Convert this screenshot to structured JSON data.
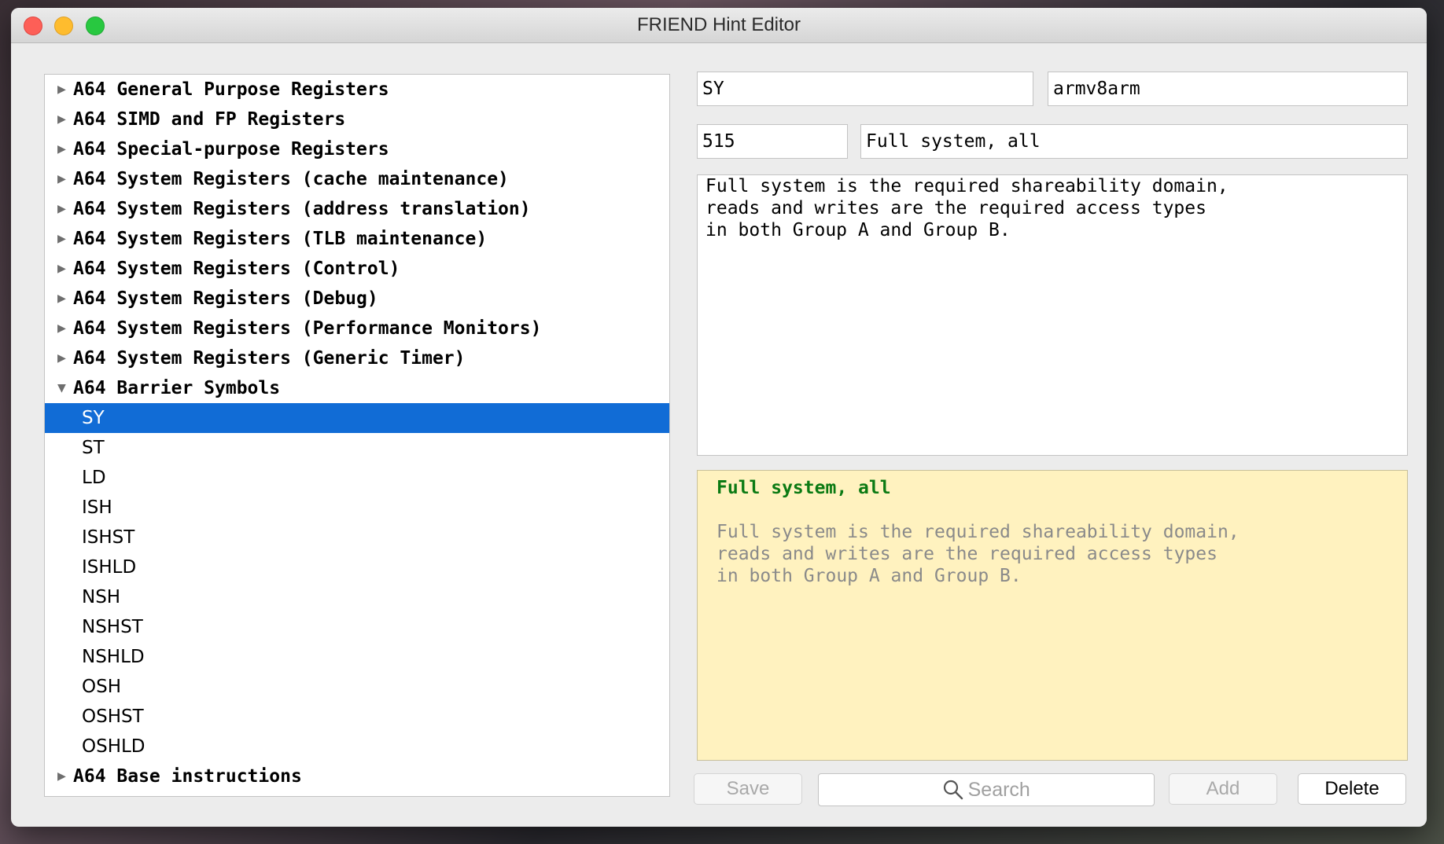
{
  "window": {
    "title": "FRIEND Hint Editor"
  },
  "tree": {
    "groups_before": [
      "A64 General Purpose Registers",
      "A64 SIMD and FP Registers",
      "A64 Special-purpose Registers",
      "A64 System Registers (cache maintenance)",
      "A64 System Registers (address translation)",
      "A64 System Registers (TLB maintenance)",
      "A64 System Registers (Control)",
      "A64 System Registers (Debug)",
      "A64 System Registers (Performance Monitors)",
      "A64 System Registers (Generic Timer)"
    ],
    "expanded_group": "A64 Barrier Symbols",
    "children": [
      "SY",
      "ST",
      "LD",
      "ISH",
      "ISHST",
      "ISHLD",
      "NSH",
      "NSHST",
      "NSHLD",
      "OSH",
      "OSHST",
      "OSHLD"
    ],
    "selected_child": "SY",
    "groups_after": [
      "A64 Base instructions"
    ],
    "icons": {
      "collapsed": "triangle-right-icon",
      "expanded": "triangle-down-icon"
    }
  },
  "editor": {
    "name": "SY",
    "arch": "armv8arm",
    "value": "515",
    "summary": "Full system, all",
    "description": "Full system is the required shareability domain,\nreads and writes are the required access types\nin both Group A and Group B."
  },
  "preview": {
    "title": "Full system, all",
    "body": "Full system is the required shareability domain,\nreads and writes are the required access types\nin both Group A and Group B."
  },
  "buttons": {
    "save": "Save",
    "add": "Add",
    "delete": "Delete"
  },
  "search": {
    "placeholder": "Search",
    "icon": "magnifier-icon"
  },
  "colors": {
    "selection": "#116cd6",
    "preview_bg": "#fff2bf",
    "preview_title": "#0b7a13"
  }
}
